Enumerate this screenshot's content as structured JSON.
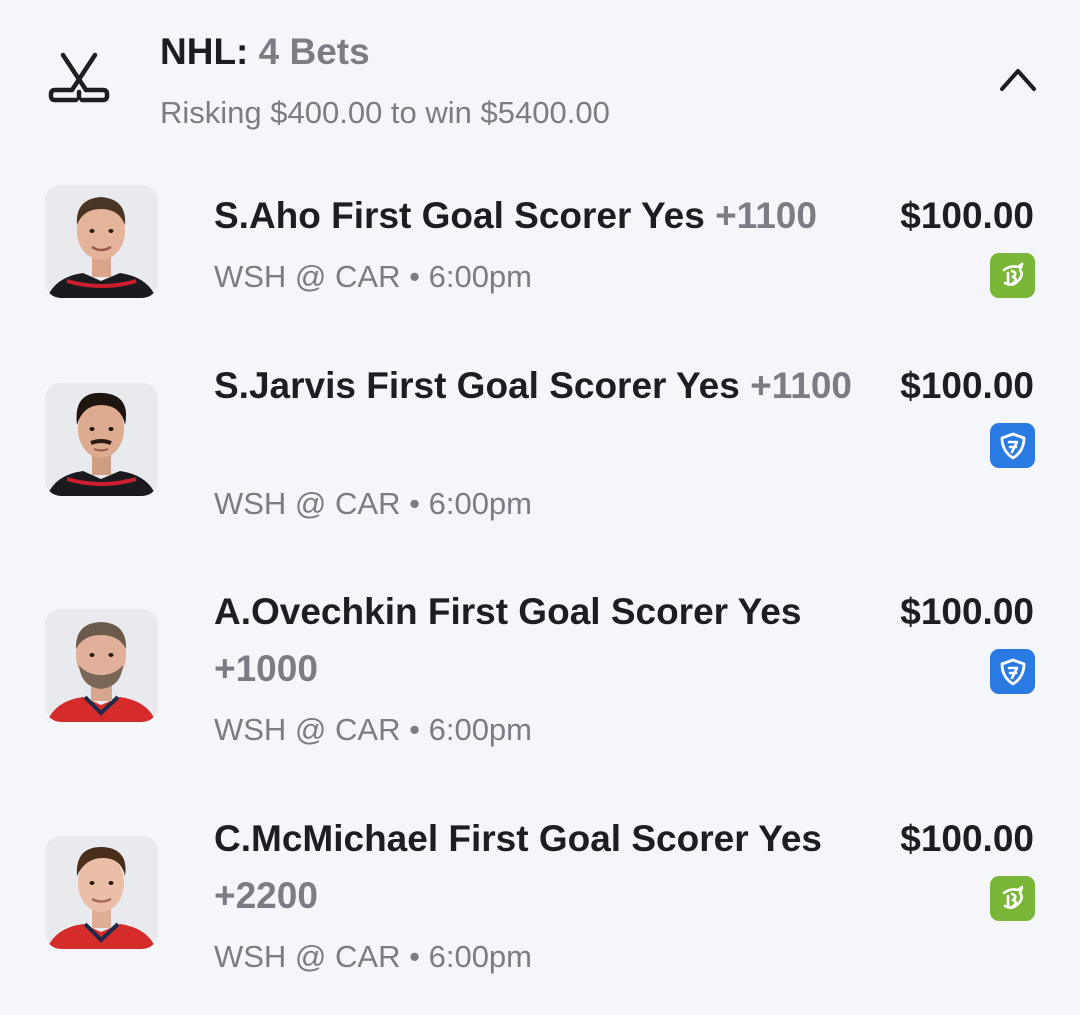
{
  "header": {
    "league": "NHL:",
    "bet_count": "4 Bets",
    "summary": "Risking $400.00 to win $5400.00",
    "icon": "hockey-sticks-icon",
    "collapse_icon": "chevron-up-icon"
  },
  "bets": [
    {
      "selection": "S.Aho First Goal Scorer Yes",
      "odds": "+1100",
      "game": "WSH @ CAR",
      "time": "6:00pm",
      "amount": "$100.00",
      "book": "draftkings-icon",
      "jersey_color": "#cc1f2e"
    },
    {
      "selection": "S.Jarvis First Goal Scorer Yes",
      "odds": "+1100",
      "game": "WSH @ CAR",
      "time": "6:00pm",
      "amount": "$100.00",
      "book": "fanduel-icon",
      "jersey_color": "#cc1f2e"
    },
    {
      "selection": "A.Ovechkin First Goal Scorer Yes",
      "odds": "+1000",
      "game": "WSH @ CAR",
      "time": "6:00pm",
      "amount": "$100.00",
      "book": "fanduel-icon",
      "jersey_color": "#d52b2b"
    },
    {
      "selection": "C.McMichael First Goal Scorer Yes",
      "odds": "+2200",
      "game": "WSH @ CAR",
      "time": "6:00pm",
      "amount": "$100.00",
      "book": "draftkings-icon",
      "jersey_color": "#d52b2b"
    }
  ],
  "separator": "•",
  "colors": {
    "background": "#f5f6fa",
    "primary_text": "#1d1d22",
    "secondary_text": "#7b7d85",
    "draftkings": "#7ab637",
    "fanduel": "#2a7ae4"
  }
}
